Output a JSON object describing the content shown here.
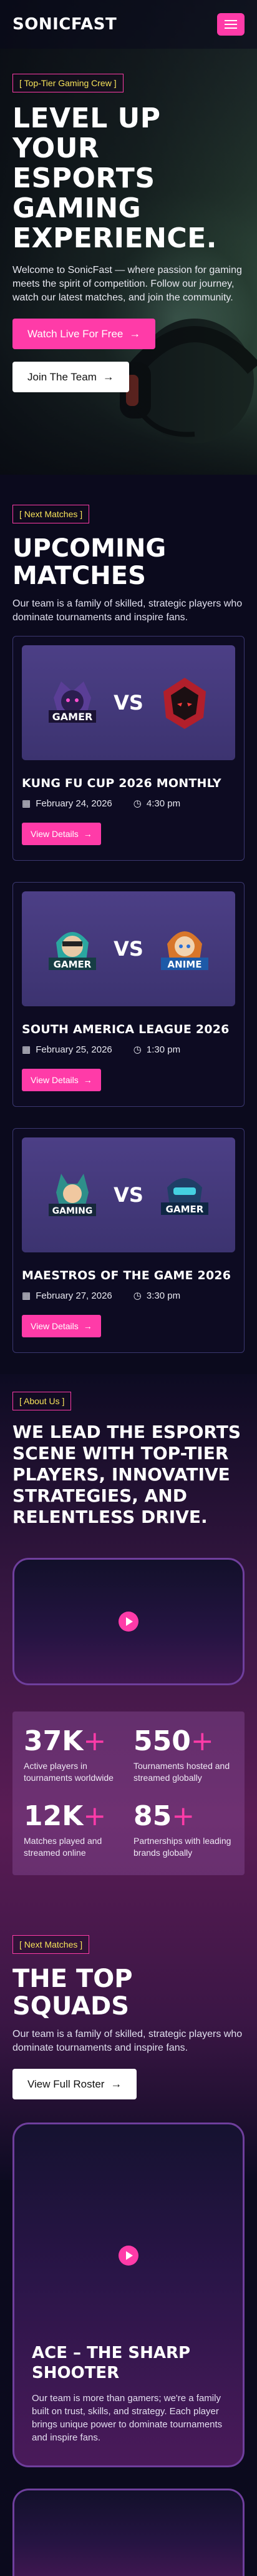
{
  "header": {
    "logo": "SONICFAST",
    "menu_icon": "hamburger-menu-icon"
  },
  "colors": {
    "accent": "#ff3ba8",
    "tag_text": "#f6e25a",
    "background": "#0b0a1d",
    "card_border": "#3b3870"
  },
  "hero": {
    "tag": "[ Top-Tier Gaming Crew ]",
    "title": "LEVEL UP YOUR ESPORTS GAMING EXPERIENCE.",
    "text": "Welcome to SonicFast — where passion for gaming meets the spirit of competition. Follow our journey, watch our latest matches, and join the community.",
    "primary_button": "Watch Live For Free",
    "secondary_button": "Join The Team"
  },
  "matches": {
    "tag": "[ Next Matches ]",
    "title": "UPCOMING MATCHES",
    "text": "Our team is a family of skilled, strategic players who dominate tournaments and inspire fans.",
    "vs_label": "VS",
    "button_label": "View Details",
    "items": [
      {
        "name": "KUNG FU CUP 2026 MONTHLY",
        "date": "February 24, 2026",
        "time": "4:30 pm",
        "left_logo": "GAMER",
        "right_logo": ""
      },
      {
        "name": "SOUTH AMERICA LEAGUE 2026",
        "date": "February 25, 2026",
        "time": "1:30 pm",
        "left_logo": "GAMER",
        "right_logo": "ANIME"
      },
      {
        "name": "MAESTROS OF THE GAME 2026",
        "date": "February 27, 2026",
        "time": "3:30 pm",
        "left_logo": "GAMING",
        "right_logo": "GAMER"
      }
    ]
  },
  "about": {
    "tag": "[ About Us ]",
    "title": "WE LEAD THE ESPORTS SCENE WITH TOP-TIER PLAYERS, INNOVATIVE STRATEGIES, AND RELENTLESS DRIVE.",
    "stats": [
      {
        "value": "37K",
        "plus": "+",
        "label": "Active players in tournaments worldwide"
      },
      {
        "value": "550",
        "plus": "+",
        "label": "Tournaments hosted and streamed globally"
      },
      {
        "value": "12K",
        "plus": "+",
        "label": "Matches played and streamed online"
      },
      {
        "value": "85",
        "plus": "+",
        "label": "Partnerships with leading brands globally"
      }
    ]
  },
  "squads": {
    "tag": "[ Next Matches ]",
    "title": "THE TOP SQUADS",
    "text": "Our team is a family of skilled, strategic players who dominate tournaments and inspire fans.",
    "button": "View Full Roster",
    "card_title": "ACE – THE SHARP SHOOTER",
    "card_text": "Our team is more than gamers; we're a family built on trust, skills, and strategy. Each player brings unique power to dominate tournaments and inspire fans."
  }
}
